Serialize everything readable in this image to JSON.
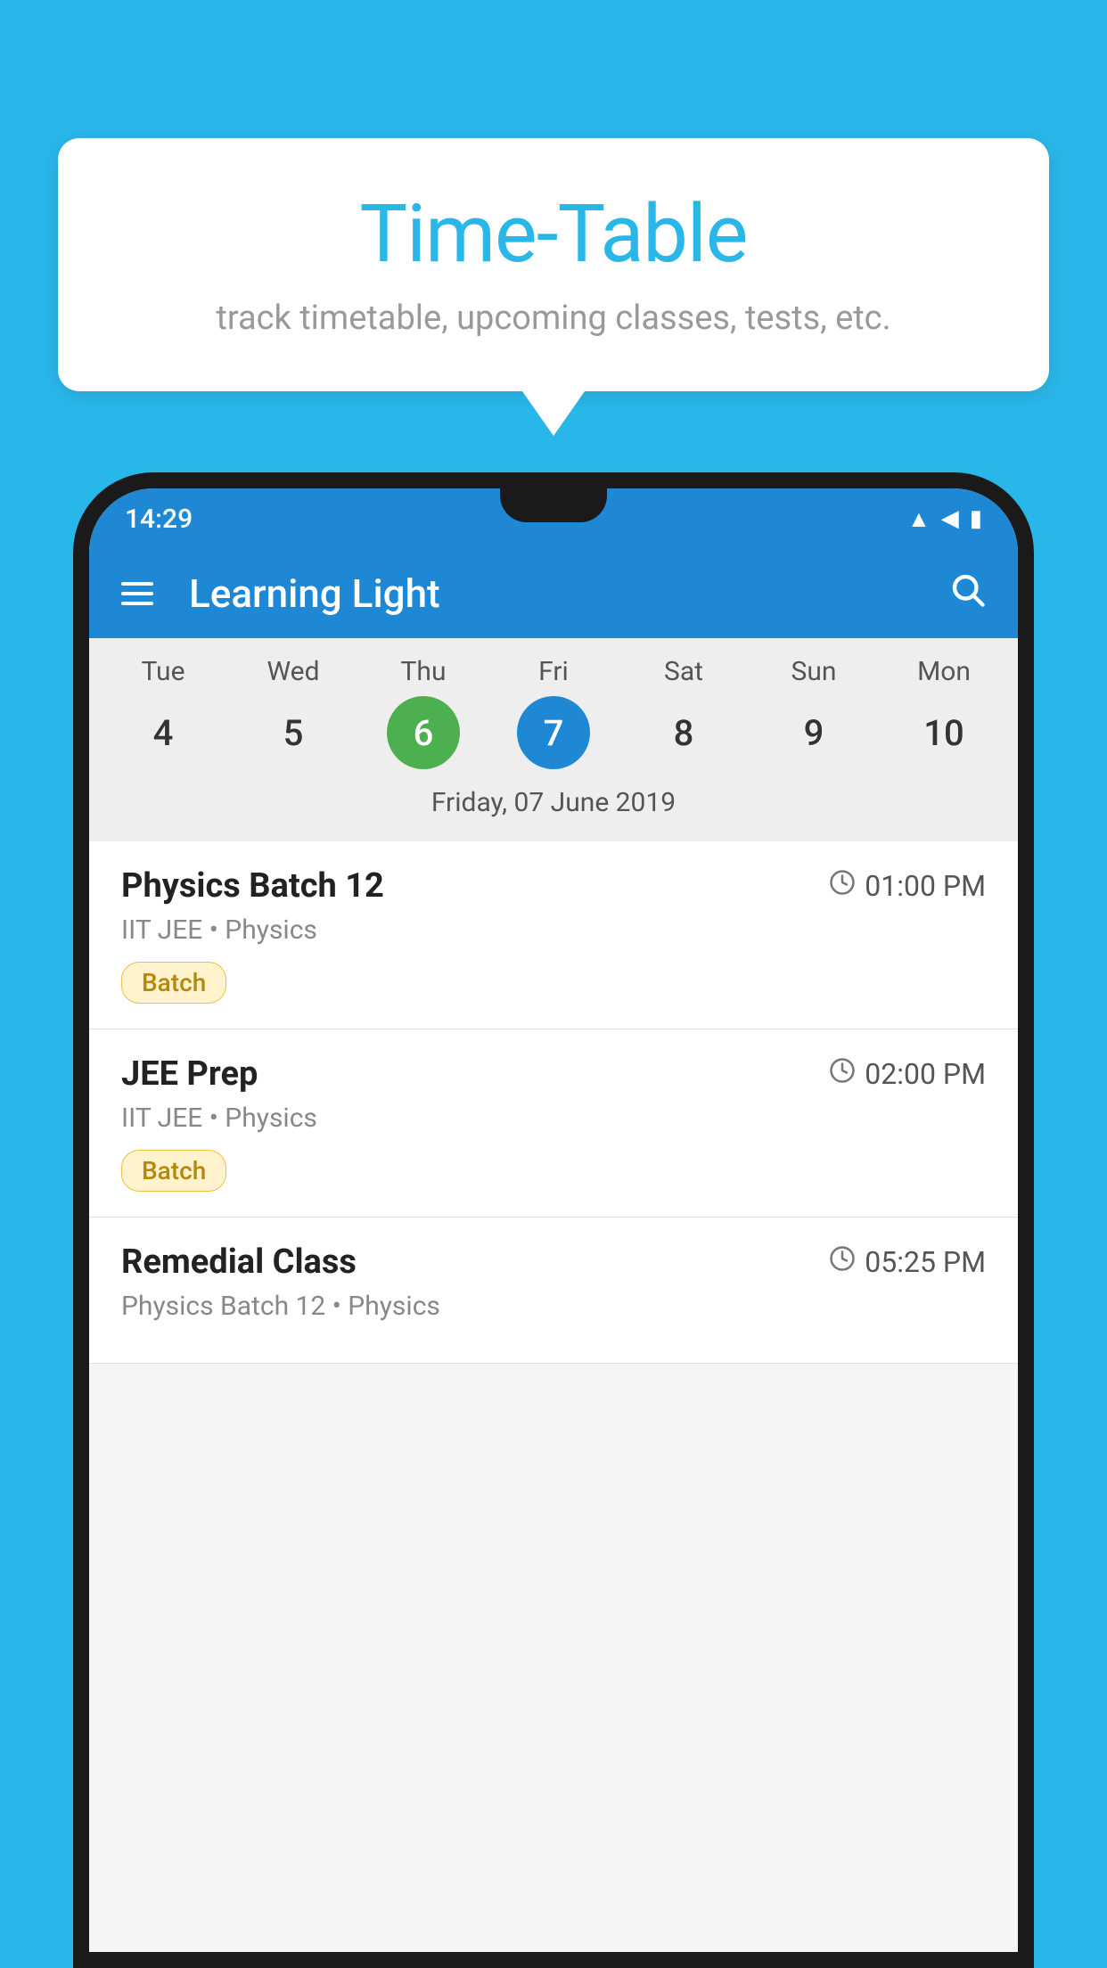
{
  "background_color": "#29b6e8",
  "speech_bubble": {
    "title": "Time-Table",
    "subtitle": "track timetable, upcoming classes, tests, etc."
  },
  "app": {
    "title": "Learning Light",
    "hamburger_label": "menu",
    "search_label": "search"
  },
  "status_bar": {
    "time": "14:29"
  },
  "calendar": {
    "days": [
      "Tue",
      "Wed",
      "Thu",
      "Fri",
      "Sat",
      "Sun",
      "Mon"
    ],
    "dates": [
      "4",
      "5",
      "6",
      "7",
      "8",
      "9",
      "10"
    ],
    "today_index": 2,
    "selected_index": 3,
    "selected_label": "Friday, 07 June 2019"
  },
  "schedule_items": [
    {
      "title": "Physics Batch 12",
      "time": "01:00 PM",
      "subtitle": "IIT JEE • Physics",
      "tag": "Batch"
    },
    {
      "title": "JEE Prep",
      "time": "02:00 PM",
      "subtitle": "IIT JEE • Physics",
      "tag": "Batch"
    },
    {
      "title": "Remedial Class",
      "time": "05:25 PM",
      "subtitle": "Physics Batch 12 • Physics",
      "tag": ""
    }
  ]
}
